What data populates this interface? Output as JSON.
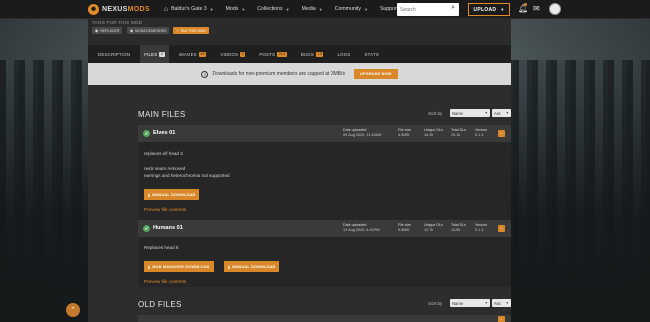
{
  "nav": {
    "logo_prefix": "NEXUS",
    "logo_suffix": "MODS",
    "game": "Baldur's Gate 3",
    "menu": [
      "Mods",
      "Collections",
      "Media",
      "Community",
      "Support"
    ],
    "search_placeholder": "Search",
    "upload_label": "UPLOAD"
  },
  "mod": {
    "tags_title": "TAGS FOR THIS MOD",
    "tags": [
      "REPLACER",
      "MODELS/MESHES"
    ],
    "add_tag": "TAG THIS MOD"
  },
  "tabs": [
    {
      "label": "DESCRIPTION",
      "count": ""
    },
    {
      "label": "FILES",
      "count": "2"
    },
    {
      "label": "IMAGES",
      "count": "48"
    },
    {
      "label": "VIDEOS",
      "count": "0"
    },
    {
      "label": "POSTS",
      "count": "213"
    },
    {
      "label": "BUGS",
      "count": "10"
    },
    {
      "label": "LOGS",
      "count": ""
    },
    {
      "label": "STATS",
      "count": ""
    }
  ],
  "notice": {
    "text": "Downloads for non-premium members are capped at 3MB/s",
    "button": "UPGRADE NOW"
  },
  "main_files": {
    "title": "MAIN FILES",
    "sort_label": "Sort by",
    "sort_field": "Name",
    "sort_order": "Asc"
  },
  "stat_labels": {
    "date": "Date uploaded",
    "size": "File size",
    "unique": "Unique DLs",
    "total": "Total DLs",
    "version": "Version"
  },
  "files": [
    {
      "name": "Elves 01",
      "date": "09 Aug 2020, 11:15AM",
      "size": "4.5MB",
      "unique": "16.2k",
      "total": "20.1k",
      "version": "0.1.1",
      "desc": [
        "replaces elf head 3",
        "",
        "neck seam removed",
        "earrings and heterochromia not supported"
      ],
      "buttons": [
        "MANUAL DOWNLOAD"
      ],
      "preview": "Preview file contents"
    },
    {
      "name": "Humans 01",
      "date": "13 Aug 2020, 4:41PM",
      "size": "9.5MB",
      "unique": "12.7k",
      "total": "14.9k",
      "version": "0.1.1",
      "desc": [
        "Replaces head 6"
      ],
      "buttons": [
        "MOD MANAGER DOWNLOAD",
        "MANUAL DOWNLOAD"
      ],
      "preview": "Preview file contents"
    }
  ],
  "old_files": {
    "title": "OLD FILES",
    "sort_label": "Sort by",
    "sort_field": "Name",
    "sort_order": "Asc"
  },
  "colors": {
    "accent": "#d98829",
    "success": "#56a85c",
    "panel": "#2d2d2d",
    "nav": "#1b1b1b"
  },
  "icons": {
    "home": "home-icon",
    "search": "search-icon",
    "bell": "bell-icon",
    "mail": "mail-icon",
    "check": "check-circle-icon",
    "back_to_top": "arrow-up-icon"
  }
}
